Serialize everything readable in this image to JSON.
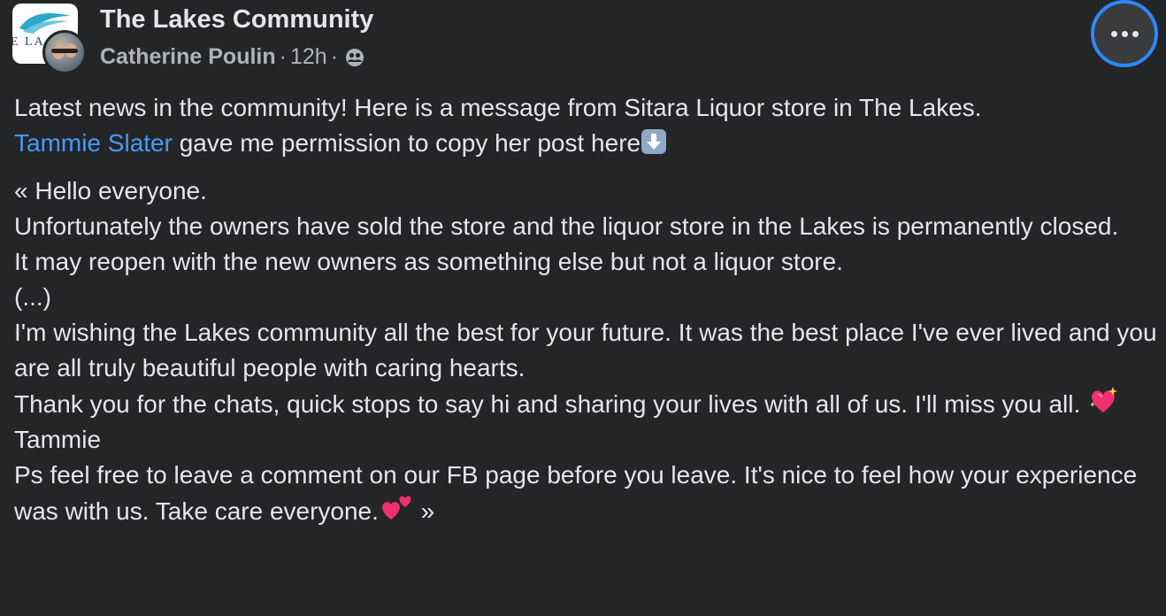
{
  "header": {
    "group_name": "The Lakes Community",
    "author": "Catherine Poulin",
    "separator": "·",
    "timestamp": "12h",
    "privacy_icon": "friends-icon",
    "more_icon": "more-options-icon",
    "group_logo_text": "E LA"
  },
  "post": {
    "intro_text": "Latest news in the community! Here is a message from Sitara Liquor store in The Lakes.",
    "mention": "Tammie Slater",
    "mention_suffix": " gave me permission to copy her post here",
    "lines": {
      "greeting": "« Hello everyone.",
      "line1": "Unfortunately the owners have sold the store and the liquor store in the Lakes is permanently closed.",
      "line2": "It may reopen with the new owners as something else but not a liquor store.",
      "line3": "(...)",
      "line4": "I'm wishing the Lakes community all the best for your future.  It was the best place I've ever lived and you are all truly beautiful people with caring hearts.",
      "line5": "Thank you for the chats, quick stops to say hi and sharing your lives with all of us. I'll miss you all. ",
      "line6": "Tammie",
      "line7": "Ps feel free to leave a comment on our FB page before you leave. It's nice to feel how your experience was with us. Take care everyone.",
      "closing_quote": " »"
    },
    "emojis": {
      "down_arrow": "down-arrow-emoji",
      "sparkling_heart": "sparkling-heart-emoji",
      "two_hearts": "two-hearts-emoji"
    }
  },
  "colors": {
    "background": "#242526",
    "text_primary": "#e4e6eb",
    "text_secondary": "#b0b3b8",
    "mention": "#4599ff",
    "focus_ring": "#2d88ff"
  }
}
